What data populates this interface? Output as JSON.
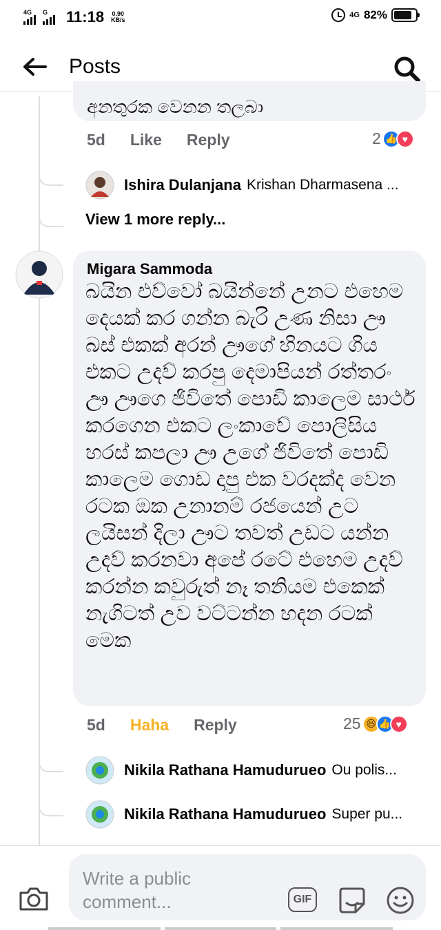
{
  "status_bar": {
    "sim1_type": "4G",
    "sim2_type": "G",
    "time": "11:18",
    "speed_value": "0.90",
    "speed_unit": "KB/s",
    "network": "4G",
    "battery": "82%",
    "battery_level": 0.82
  },
  "header": {
    "title": "Posts",
    "back_icon": "arrow-left-icon",
    "search_icon": "search-icon"
  },
  "prev_comment": {
    "text_tail": "අනතුරක වෙනන තලබා",
    "time": "5d",
    "like_label": "Like",
    "reply_label": "Reply",
    "reaction_count": "2",
    "reactions": [
      "like",
      "love"
    ]
  },
  "prev_replies": [
    {
      "name": "Ishira Dulanjana",
      "snippet": "Krishan Dharmasena ..."
    }
  ],
  "view_more_label": "View 1 more reply...",
  "main_comment": {
    "author": "Migara Sammoda",
    "text": "බයින එව්වෝ බයින්නේ උනට එහෙම දෙයක් කර ගන්න බැරි උණ නිසා ඌ බස් එකක්  අරන් ඌගේ හිනයට ගිය එකට උදව් කරපු දෙමාපියන් රත්තරං ඌ ඌගෙ ජිවිතේ පොඩි කාලෙම සාර්ථ කරගෙන එකට ලංකාවේ පොලිසිය හරස් කපලා ඌ උගේ ජිවිතේ පොඩි කාලෙම ගොඩ දාපු එක වරදක්ද වෙන රටක ඔක උනානම් රජයෙන් උට ලයිසන් දිලා ඌට තවත් උඩට යන්න උදව් කරනවා අපේ රටේ එහෙම උදව් කරන්න කවුරුත් නෑ තනියම එකෙක් නැගිටත් උව වට්ටන්න හදන රටක් මෙක",
    "time": "5d",
    "reaction_label": "Haha",
    "reply_label": "Reply",
    "reaction_count": "25",
    "reactions": [
      "haha",
      "like",
      "love"
    ],
    "haha_color": "#f7b125"
  },
  "main_replies": [
    {
      "name": "Nikila Rathana Hamudurueo",
      "snippet": "Ou  polis..."
    },
    {
      "name": "Nikila Rathana Hamudurueo",
      "snippet": "Super pu..."
    }
  ],
  "composer": {
    "placeholder": "Write a public comment...",
    "camera_icon": "camera-icon",
    "gif_label": "GIF",
    "sticker_icon": "sticker-icon",
    "emoji_icon": "emoji-icon"
  },
  "colors": {
    "accent_blue": "#1877f2",
    "love_red": "#f33e58",
    "bubble_bg": "#f0f2f5",
    "meta_gray": "#65676b"
  }
}
